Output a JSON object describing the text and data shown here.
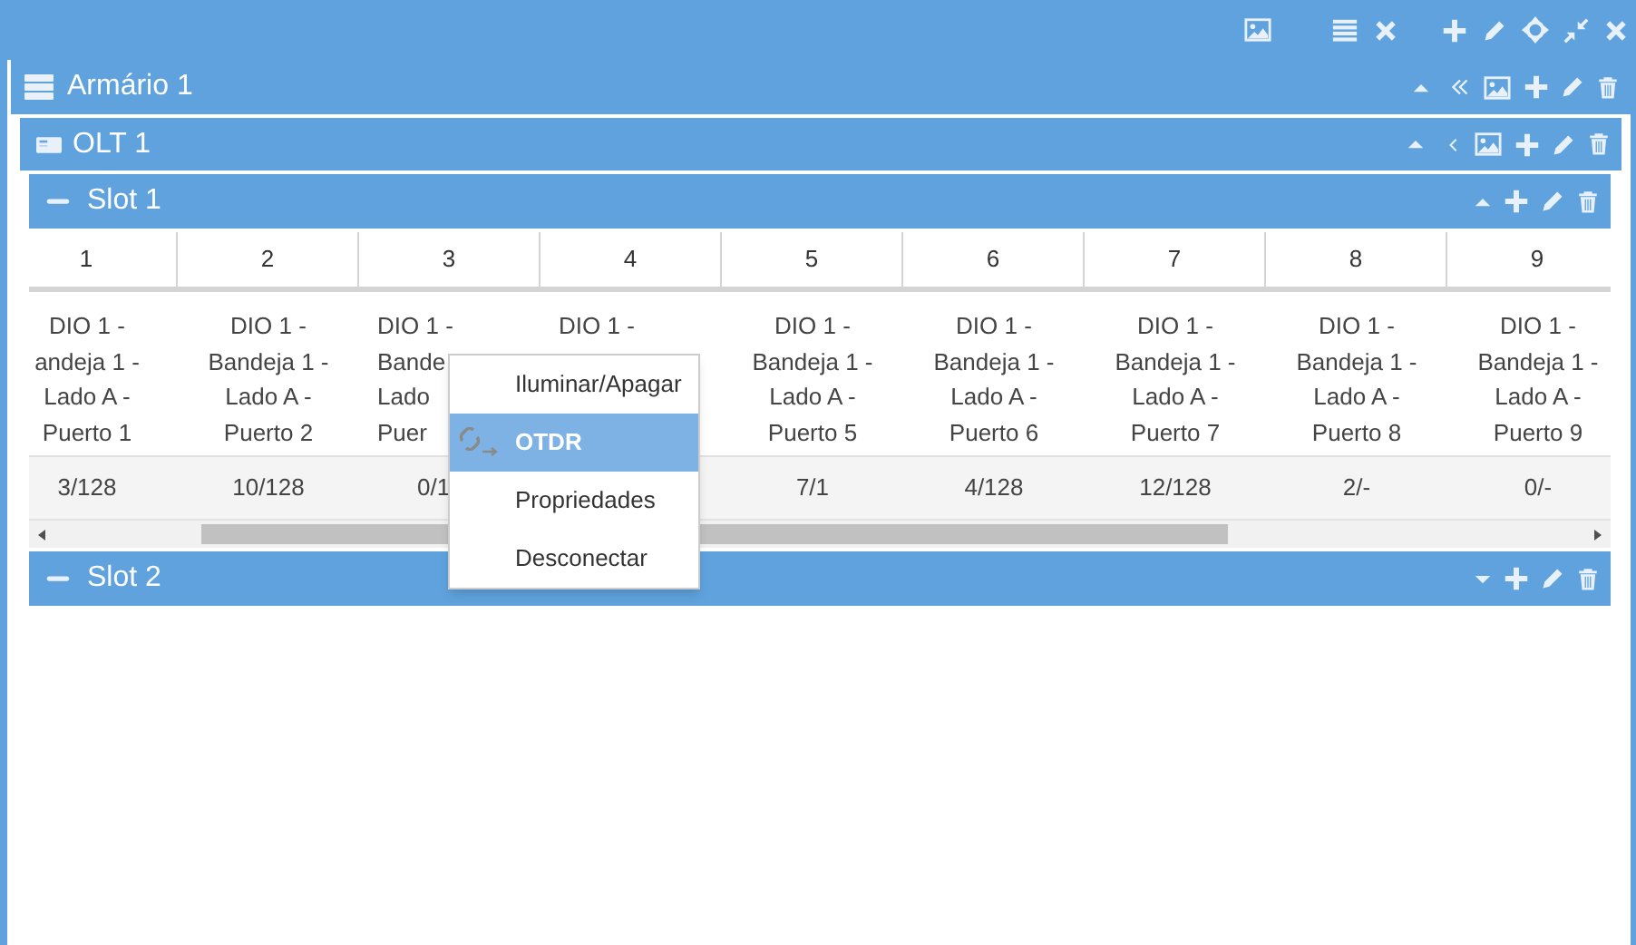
{
  "cabinet": {
    "title": "Armário 1"
  },
  "olt": {
    "title": "OLT 1"
  },
  "slots": [
    {
      "title": "Slot 1",
      "expanded": true
    },
    {
      "title": "Slot 2",
      "expanded": false
    }
  ],
  "table": {
    "columns": [
      "1",
      "2",
      "3",
      "4",
      "5",
      "6",
      "7",
      "8",
      "9"
    ],
    "cells": [
      {
        "lines": [
          "DIO 1 -",
          "andeja 1 -",
          "Lado A -",
          "Puerto 1"
        ],
        "count": "3/128",
        "covered": false
      },
      {
        "lines": [
          "DIO 1 -",
          "Bandeja 1 -",
          "Lado A -",
          "Puerto 2"
        ],
        "count": "10/128",
        "covered": false
      },
      {
        "lines": [
          "DIO 1 -",
          "Bande",
          "Lado",
          "Puer"
        ],
        "count": "0/1",
        "covered": true
      },
      {
        "lines": [
          "DIO 1 -"
        ],
        "covered": true
      },
      {
        "lines": [
          "DIO 1 -",
          "Bandeja 1 -",
          "Lado A -",
          "Puerto 5"
        ],
        "count": "7/1",
        "covered": false
      },
      {
        "lines": [
          "DIO 1 -",
          "Bandeja 1 -",
          "Lado A -",
          "Puerto 6"
        ],
        "count": "4/128",
        "covered": false
      },
      {
        "lines": [
          "DIO 1 -",
          "Bandeja 1 -",
          "Lado A -",
          "Puerto 7"
        ],
        "count": "12/128",
        "covered": false
      },
      {
        "lines": [
          "DIO 1 -",
          "Bandeja 1 -",
          "Lado A -",
          "Puerto 8"
        ],
        "count": "2/-",
        "covered": false
      },
      {
        "lines": [
          "DIO 1 -",
          "Bandeja 1 -",
          "Lado A -",
          "Puerto 9"
        ],
        "count": "0/-",
        "covered": false
      }
    ]
  },
  "context_menu": {
    "items": [
      {
        "label": "Iluminar/Apagar",
        "kind": "plain",
        "selected": false
      },
      {
        "label": "OTDR",
        "kind": "link-test",
        "selected": true
      },
      {
        "label": "Propriedades",
        "kind": "plain",
        "selected": false
      },
      {
        "label": "Desconectar",
        "kind": "plain",
        "selected": false
      }
    ]
  }
}
